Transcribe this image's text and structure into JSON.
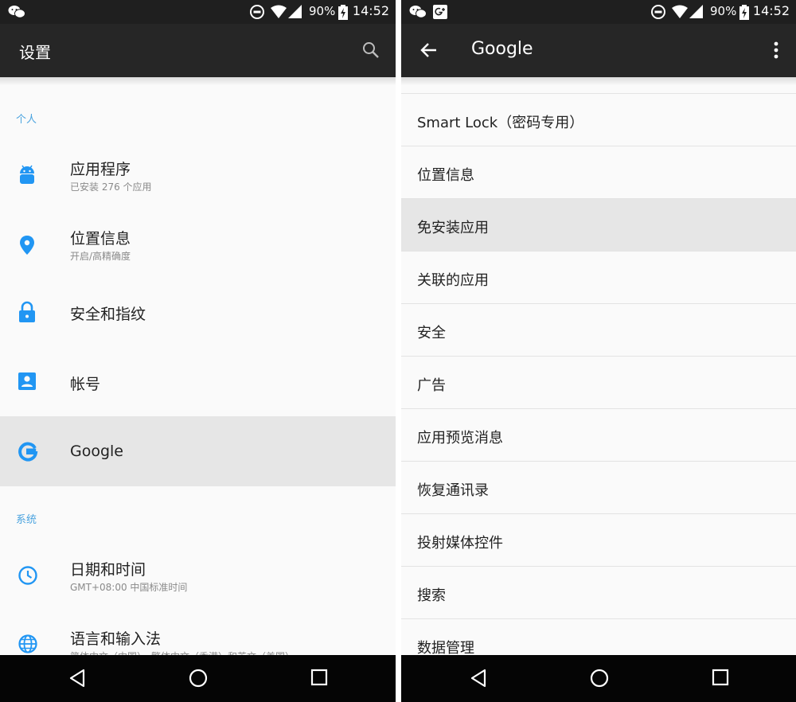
{
  "status_bar": {
    "battery": "90%",
    "time": "14:52"
  },
  "left": {
    "title": "设置",
    "sections": [
      {
        "header": "个人",
        "items": [
          {
            "title": "应用程序",
            "subtitle": "已安装 276 个应用",
            "icon": "android-icon"
          },
          {
            "title": "位置信息",
            "subtitle": "开启/高精确度",
            "icon": "location-pin-icon"
          },
          {
            "title": "安全和指纹",
            "subtitle": "",
            "icon": "lock-icon"
          },
          {
            "title": "帐号",
            "subtitle": "",
            "icon": "account-box-icon"
          },
          {
            "title": "Google",
            "subtitle": "",
            "icon": "google-g-icon"
          }
        ]
      },
      {
        "header": "系统",
        "items": [
          {
            "title": "日期和时间",
            "subtitle": "GMT+08:00 中国标准时间",
            "icon": "clock-icon"
          },
          {
            "title": "语言和输入法",
            "subtitle": "简体中文（中国）、繁体中文（香港）和英文（美国）",
            "icon": "globe-icon"
          }
        ]
      }
    ]
  },
  "right": {
    "title": "Google",
    "items": [
      "Smart Lock（密码专用）",
      "位置信息",
      "免安装应用",
      "关联的应用",
      "安全",
      "广告",
      "应用预览消息",
      "恢复通讯录",
      "投射媒体控件",
      "搜索",
      "数据管理"
    ]
  },
  "colors": {
    "accent": "#2196f3",
    "section_header": "#4aa3df",
    "appbar": "#262626",
    "statusbar": "#1f1f1f"
  }
}
